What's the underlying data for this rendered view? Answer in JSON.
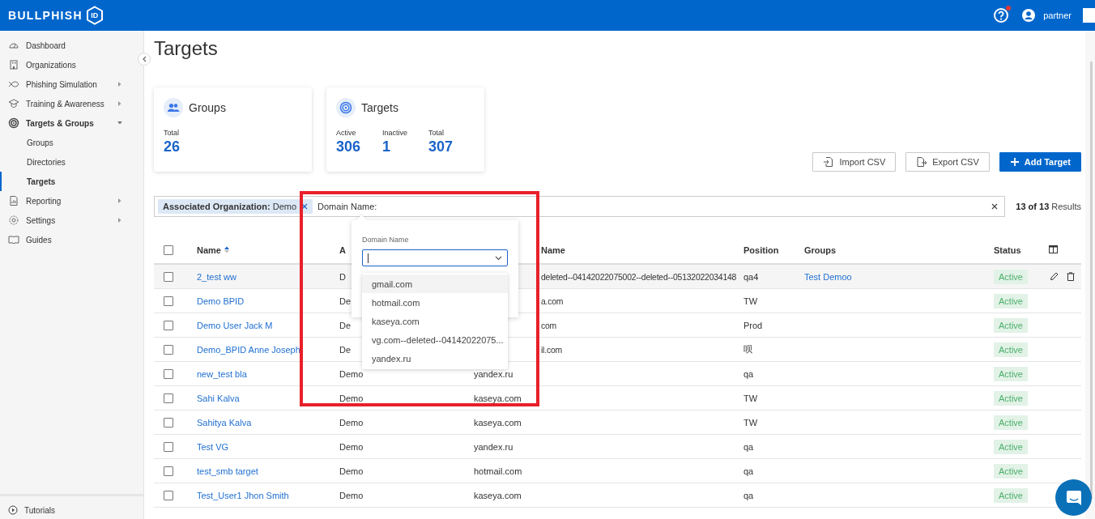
{
  "header": {
    "logo_text": "BULLPHISH",
    "logo_badge": "ID",
    "help_notification": true,
    "user_name": "partner"
  },
  "sidebar": {
    "items": [
      {
        "label": "Dashboard",
        "selected": false
      },
      {
        "label": "Organizations",
        "selected": false
      },
      {
        "label": "Phishing Simulation",
        "selected": false,
        "expanded": false
      },
      {
        "label": "Training & Awareness",
        "selected": false,
        "expanded": false
      },
      {
        "label": "Targets & Groups",
        "selected": true,
        "expanded": true,
        "children": [
          {
            "label": "Groups",
            "selected": false
          },
          {
            "label": "Directories",
            "selected": false
          },
          {
            "label": "Targets",
            "selected": true
          }
        ]
      },
      {
        "label": "Reporting",
        "selected": false,
        "expanded": false
      },
      {
        "label": "Settings",
        "selected": false,
        "expanded": false
      },
      {
        "label": "Guides",
        "selected": false
      }
    ],
    "footer_item": {
      "label": "Tutorials"
    }
  },
  "page_title": "Targets",
  "cards": [
    {
      "title": "Groups",
      "stats": [
        {
          "label": "Total",
          "value": "26"
        }
      ]
    },
    {
      "title": "Targets",
      "stats": [
        {
          "label": "Active",
          "value": "306"
        },
        {
          "label": "Inactive",
          "value": "1"
        },
        {
          "label": "Total",
          "value": "307"
        }
      ]
    }
  ],
  "actions": [
    {
      "label": "Import CSV",
      "kind": "import"
    },
    {
      "label": "Export CSV",
      "kind": "export"
    },
    {
      "label": "Add Target",
      "kind": "add"
    }
  ],
  "filter": {
    "chips": [
      {
        "text": "**Associated Organization:** Demo"
      }
    ],
    "value": "Domain Name:",
    "results": "**13 of 13** Results"
  },
  "domain_popup": {
    "label": "Domain Name",
    "options": [
      {
        "label": "gmail.com",
        "highlighted": true
      },
      {
        "label": "hotmail.com",
        "highlighted": false
      },
      {
        "label": "kaseya.com",
        "highlighted": false
      },
      {
        "label": "vg.com--deleted--04142022075...",
        "highlighted": false
      },
      {
        "label": "yandex.ru",
        "highlighted": false
      }
    ]
  },
  "table": {
    "columns": [
      {
        "label": "Name",
        "sortable": true,
        "covered": false
      },
      {
        "label": "A",
        "sortable": false,
        "covered": false
      },
      {
        "label": "Name",
        "sortable": false,
        "covered": true
      },
      {
        "label": "Position",
        "sortable": false,
        "covered": false
      },
      {
        "label": "Groups",
        "sortable": false,
        "covered": false
      },
      {
        "label": "Status",
        "sortable": false,
        "covered": false
      }
    ],
    "rows": [
      {
        "name": "2_test ww",
        "organization": "D",
        "domain": "deleted--04142022075002--deleted--05132022034148",
        "position": "qa4",
        "group": "Test Demoo",
        "status": "Active",
        "checked": false,
        "highlighted": true,
        "covered": true
      },
      {
        "name": "Demo BPID",
        "organization": "De",
        "domain": "a.com",
        "position": "TW",
        "status": "Active",
        "checked": false,
        "highlighted": false,
        "covered": true
      },
      {
        "name": "Demo User Jack M",
        "organization": "De",
        "domain": "com",
        "position": "Prod",
        "status": "Active",
        "checked": false,
        "highlighted": false,
        "covered": true
      },
      {
        "name": "Demo_BPID Anne Joseph",
        "organization": "De",
        "domain": "il.com",
        "position": "呗",
        "status": "Active",
        "checked": false,
        "highlighted": false,
        "covered": true
      },
      {
        "name": "new_test bla",
        "organization": "Demo",
        "domain": "yandex.ru",
        "position": "qa",
        "status": "Active",
        "checked": false,
        "highlighted": false,
        "covered": false
      },
      {
        "name": "Sahi Kalva",
        "organization": "Demo",
        "domain": "kaseya.com",
        "position": "TW",
        "status": "Active",
        "checked": false,
        "highlighted": false,
        "covered": false
      },
      {
        "name": "Sahitya Kalva",
        "organization": "Demo",
        "domain": "kaseya.com",
        "position": "TW",
        "status": "Active",
        "checked": false,
        "highlighted": false,
        "covered": false
      },
      {
        "name": "Test VG",
        "organization": "Demo",
        "domain": "yandex.ru",
        "position": "qa",
        "status": "Active",
        "checked": false,
        "highlighted": false,
        "covered": false
      },
      {
        "name": "test_smb target",
        "organization": "Demo",
        "domain": "hotmail.com",
        "position": "qa",
        "status": "Active",
        "checked": false,
        "highlighted": false,
        "covered": false
      },
      {
        "name": "Test_User1 Jhon Smith",
        "organization": "Demo",
        "domain": "kaseya.com",
        "position": "qa",
        "status": "Active",
        "checked": false,
        "highlighted": false,
        "covered": false
      }
    ],
    "select_all_checked": false
  }
}
